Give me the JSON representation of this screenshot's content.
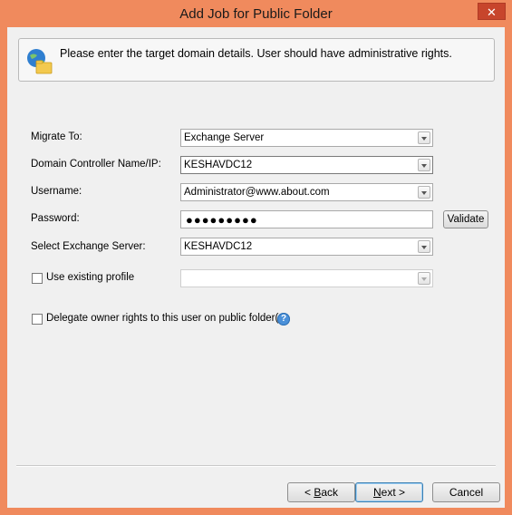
{
  "window": {
    "title": "Add Job for Public Folder",
    "close_glyph": "✕"
  },
  "header": {
    "icon": "globe-folder-icon",
    "message": "Please enter the target domain details. User should have administrative rights."
  },
  "form": {
    "migrate_to": {
      "label": "Migrate To:",
      "value": "Exchange Server"
    },
    "domain_controller": {
      "label": "Domain Controller Name/IP:",
      "value": "KESHAVDC12"
    },
    "username": {
      "label": "Username:",
      "value": "Administrator@www.about.com"
    },
    "password": {
      "label": "Password:",
      "masked_value": "●●●●●●●●●",
      "validate_label": "Validate"
    },
    "exchange_server": {
      "label": "Select Exchange Server:",
      "value": "KESHAVDC12"
    },
    "existing_profile": {
      "label": "Use existing profile",
      "checked": false,
      "value": ""
    },
    "delegate_rights": {
      "label": "Delegate owner rights to this user on public folder(s).",
      "checked": false
    }
  },
  "buttons": {
    "back": {
      "accel": "B",
      "rest": "ack",
      "prefix": "< "
    },
    "next": {
      "accel": "N",
      "rest": "ext",
      "suffix": " >"
    },
    "cancel": "Cancel"
  }
}
